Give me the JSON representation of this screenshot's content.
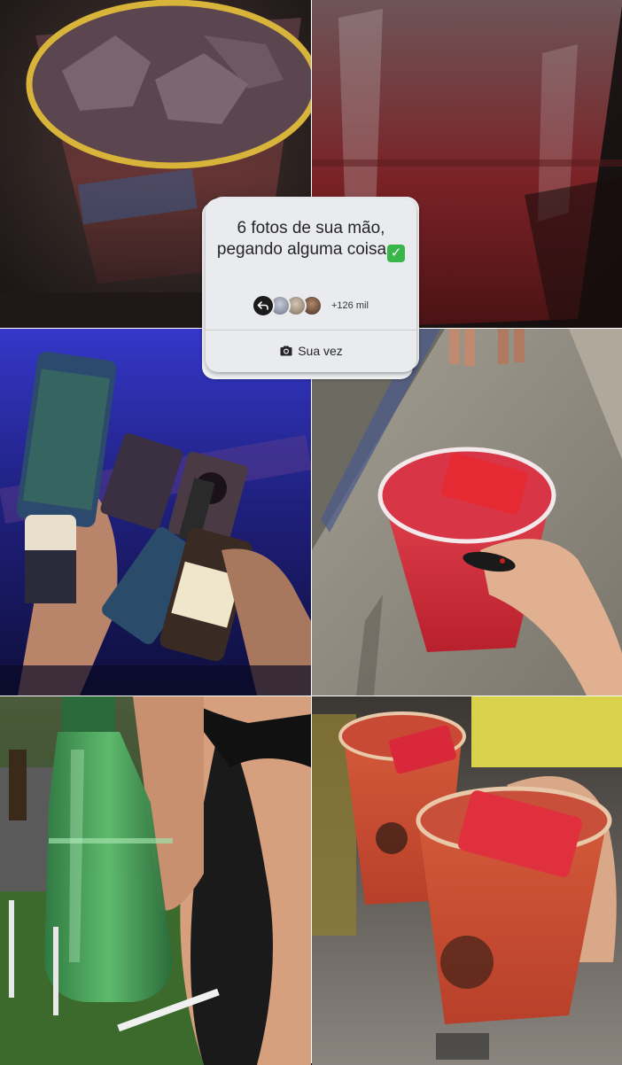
{
  "sticker": {
    "prompt_text": "6 fotos de sua mão, pegando alguma coisa",
    "check_emoji": "✓",
    "participants_count": "+126 mil",
    "action_label": "Sua vez",
    "icons": [
      "reply-arrow-icon",
      "camera-icon"
    ]
  },
  "photos": [
    {
      "name": "photo-cup-ice",
      "background": "#2b1f1f",
      "accent": "#d9b43a"
    },
    {
      "name": "photo-cup-red-blur",
      "background": "#3a1616",
      "accent": "#8c1e22"
    },
    {
      "name": "photo-bottles-blue",
      "background": "#1b1a66",
      "accent": "#232a8e"
    },
    {
      "name": "photo-red-drink-street",
      "background": "#8f8a80",
      "accent": "#d8323e"
    },
    {
      "name": "photo-green-bottle",
      "background": "#2e3a22",
      "accent": "#3f9a4f"
    },
    {
      "name": "photo-two-cups",
      "background": "#6b6660",
      "accent": "#c9452f"
    }
  ]
}
